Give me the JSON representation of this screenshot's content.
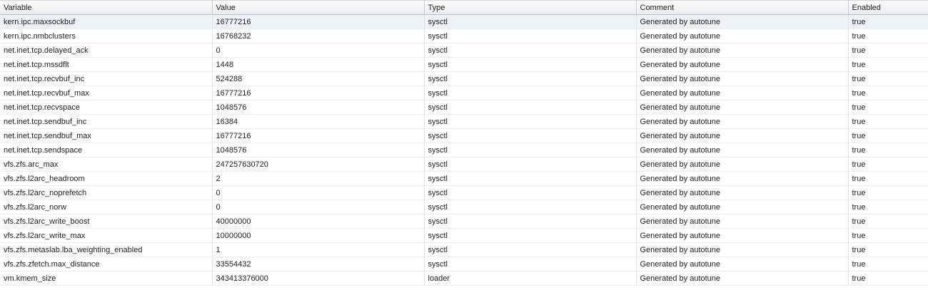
{
  "table": {
    "columns": [
      "Variable",
      "Value",
      "Type",
      "Comment",
      "Enabled"
    ],
    "rows": [
      [
        "kern.ipc.maxsockbuf",
        "16777216",
        "sysctl",
        "Generated by autotune",
        "true"
      ],
      [
        "kern.ipc.nmbclusters",
        "16768232",
        "sysctl",
        "Generated by autotune",
        "true"
      ],
      [
        "net.inet.tcp.delayed_ack",
        "0",
        "sysctl",
        "Generated by autotune",
        "true"
      ],
      [
        "net.inet.tcp.mssdflt",
        "1448",
        "sysctl",
        "Generated by autotune",
        "true"
      ],
      [
        "net.inet.tcp.recvbuf_inc",
        "524288",
        "sysctl",
        "Generated by autotune",
        "true"
      ],
      [
        "net.inet.tcp.recvbuf_max",
        "16777216",
        "sysctl",
        "Generated by autotune",
        "true"
      ],
      [
        "net.inet.tcp.recvspace",
        "1048576",
        "sysctl",
        "Generated by autotune",
        "true"
      ],
      [
        "net.inet.tcp.sendbuf_inc",
        "16384",
        "sysctl",
        "Generated by autotune",
        "true"
      ],
      [
        "net.inet.tcp.sendbuf_max",
        "16777216",
        "sysctl",
        "Generated by autotune",
        "true"
      ],
      [
        "net.inet.tcp.sendspace",
        "1048576",
        "sysctl",
        "Generated by autotune",
        "true"
      ],
      [
        "vfs.zfs.arc_max",
        "247257630720",
        "sysctl",
        "Generated by autotune",
        "true"
      ],
      [
        "vfs.zfs.l2arc_headroom",
        "2",
        "sysctl",
        "Generated by autotune",
        "true"
      ],
      [
        "vfs.zfs.l2arc_noprefetch",
        "0",
        "sysctl",
        "Generated by autotune",
        "true"
      ],
      [
        "vfs.zfs.l2arc_norw",
        "0",
        "sysctl",
        "Generated by autotune",
        "true"
      ],
      [
        "vfs.zfs.l2arc_write_boost",
        "40000000",
        "sysctl",
        "Generated by autotune",
        "true"
      ],
      [
        "vfs.zfs.l2arc_write_max",
        "10000000",
        "sysctl",
        "Generated by autotune",
        "true"
      ],
      [
        "vfs.zfs.metaslab.lba_weighting_enabled",
        "1",
        "sysctl",
        "Generated by autotune",
        "true"
      ],
      [
        "vfs.zfs.zfetch.max_distance",
        "33554432",
        "sysctl",
        "Generated by autotune",
        "true"
      ],
      [
        "vm.kmem_size",
        "343413376000",
        "loader",
        "Generated by autotune",
        "true"
      ]
    ]
  }
}
